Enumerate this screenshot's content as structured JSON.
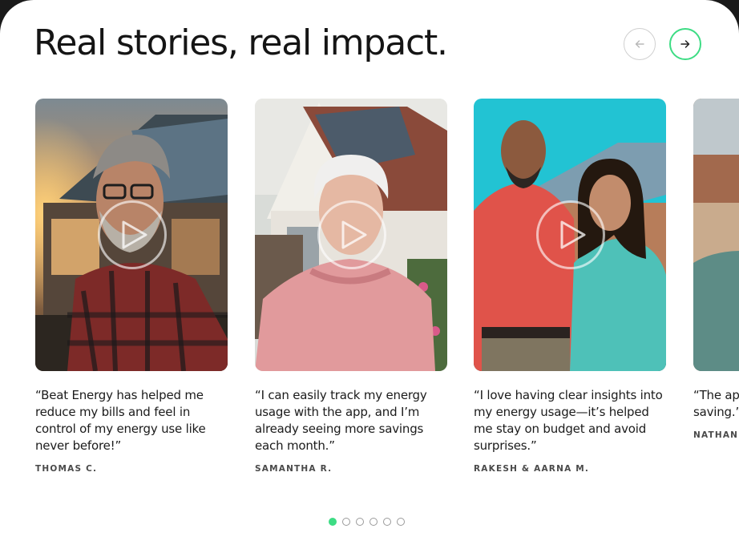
{
  "section": {
    "title": "Real stories, real impact."
  },
  "nav": {
    "prev_icon": "arrow-left-icon",
    "next_icon": "arrow-right-icon",
    "accent_color": "#3ddc84"
  },
  "testimonials": [
    {
      "quote": "“Beat Energy has helped me reduce my bills and feel in control of my energy use like never before!”",
      "name": "Thomas C."
    },
    {
      "quote": "“I can easily track my energy usage with the app, and I’m already seeing more savings each month.”",
      "name": "Samantha R."
    },
    {
      "quote": "“I love having clear insights into my energy usage—it’s helped me stay on budget and avoid surprises.”",
      "name": "Rakesh & Aarna M."
    },
    {
      "quote": "“The ap energy s impress saving.”",
      "name": "Nathan H"
    }
  ],
  "pagination": {
    "total": 6,
    "active_index": 0
  }
}
